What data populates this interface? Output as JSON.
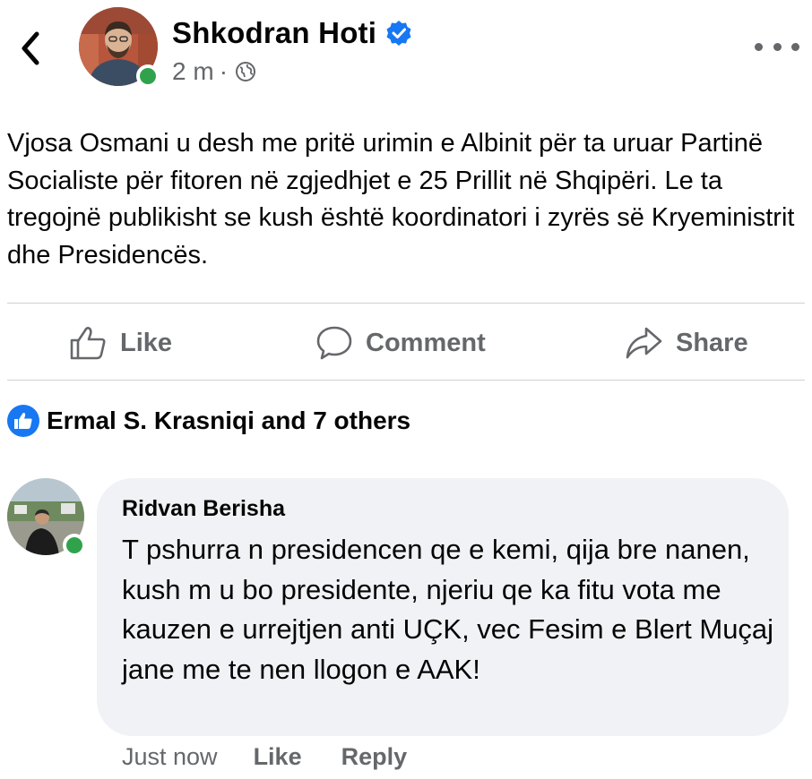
{
  "post": {
    "author": "Shkodran Hoti",
    "time": "2 m",
    "separator": "·",
    "text": "Vjosa Osmani u desh me pritë urimin e Albinit për ta uruar Partinë Socialiste për fitoren në zgjedhjet e 25 Prillit në Shqipëri. Le ta tregojnë publikisht se kush është koordinatori i zyrës së Kryeministrit dhe Presidencës."
  },
  "actions": {
    "like": "Like",
    "comment": "Comment",
    "share": "Share"
  },
  "reactions": {
    "summary": "Ermal S. Krasniqi and 7 others"
  },
  "comment": {
    "author": "Ridvan Berisha",
    "text": "T pshurra n presidencen qe e kemi, qija bre nanen, kush m u bo presidente, njeriu qe ka fitu vota me kauzen e urrejtjen anti  UÇK, vec Fesim e Blert Muçaj jane me te nen llogon e AAK!",
    "time": "Just now",
    "like": "Like",
    "reply": "Reply"
  },
  "colors": {
    "accent": "#1877f2",
    "online": "#31a24c",
    "secondary_text": "#65676b",
    "bubble": "#f0f2f5"
  },
  "icons": [
    "back-chevron-icon",
    "verified-badge-icon",
    "globe-icon",
    "more-dots-icon",
    "thumbs-up-icon",
    "comment-icon",
    "share-arrow-icon",
    "like-reaction-icon"
  ]
}
